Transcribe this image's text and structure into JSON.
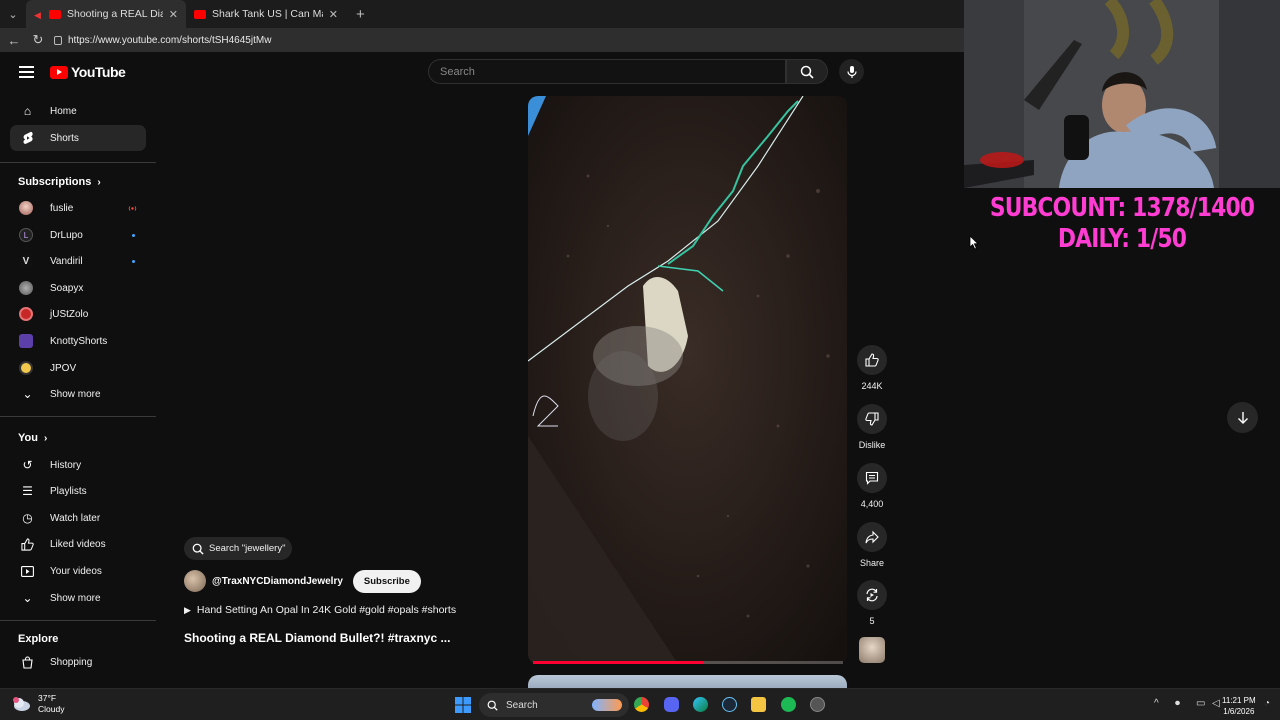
{
  "browser": {
    "tabs": [
      {
        "title": "Shooting a REAL Diamond Bu",
        "active": true
      },
      {
        "title": "Shark Tank US | Can Mark Persuad",
        "active": false
      }
    ],
    "url": "https://www.youtube.com/shorts/tSH4645jtMw"
  },
  "header": {
    "logo_text": "YouTube",
    "search_placeholder": "Search"
  },
  "sidebar": {
    "main": [
      {
        "label": "Home",
        "icon": "home-icon"
      },
      {
        "label": "Shorts",
        "icon": "shorts-icon",
        "active": true
      }
    ],
    "subscriptions_title": "Subscriptions",
    "subscriptions": [
      {
        "label": "fuslie",
        "status": "live"
      },
      {
        "label": "DrLupo",
        "status": "new"
      },
      {
        "label": "Vandiril",
        "status": "new"
      },
      {
        "label": "Soapyx",
        "status": ""
      },
      {
        "label": "jUStZolo",
        "status": ""
      },
      {
        "label": "KnottyShorts",
        "status": ""
      },
      {
        "label": "JPOV",
        "status": ""
      }
    ],
    "show_more_1": "Show more",
    "you_title": "You",
    "you_items": [
      {
        "label": "History",
        "icon": "history-icon"
      },
      {
        "label": "Playlists",
        "icon": "playlists-icon"
      },
      {
        "label": "Watch later",
        "icon": "watch-later-icon"
      },
      {
        "label": "Liked videos",
        "icon": "liked-videos-icon"
      },
      {
        "label": "Your videos",
        "icon": "your-videos-icon"
      }
    ],
    "show_more_2": "Show more",
    "explore_title": "Explore",
    "explore_items": [
      {
        "label": "Shopping",
        "icon": "shopping-icon"
      }
    ]
  },
  "short": {
    "search_chip": "Search \"jewellery\"",
    "channel": "@TraxNYCDiamondJewelry",
    "subscribe": "Subscribe",
    "song": "Hand Setting An Opal In 24K Gold #gold #opals #shorts",
    "title": "Shooting a REAL Diamond Bullet?! #traxnyc ...",
    "progress": 0.55
  },
  "actions": {
    "like": "244K",
    "dislike": "Dislike",
    "comments": "4,400",
    "share": "Share",
    "remix": "5"
  },
  "overlay": {
    "line1": "SUBCOUNT: 1378/1400",
    "line2": "DAILY: 1/50"
  },
  "taskbar": {
    "temp": "37°F",
    "condition": "Cloudy",
    "search": "Search",
    "time": "11:21 PM",
    "date": "1/6/2026"
  },
  "colors": {
    "accent": "#ff0000",
    "overlay_text": "#ff3dd2",
    "background": "#0f0f0f"
  }
}
